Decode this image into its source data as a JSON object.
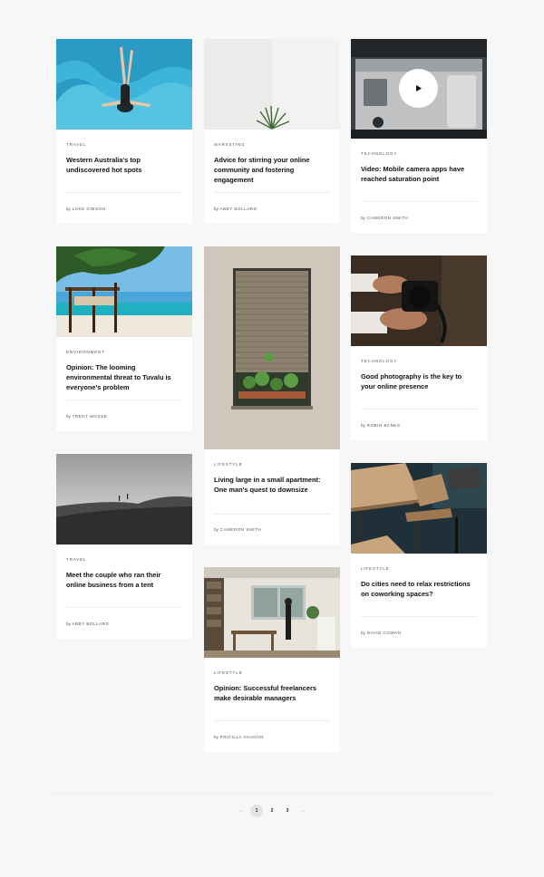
{
  "cards": [
    {
      "category": "TRAVEL",
      "title": "Western Australia's top undiscovered hot spots",
      "by": "by",
      "author": "LUKE GIBSON"
    },
    {
      "category": "MARKETING",
      "title": "Advice for stirring your online community and fostering engagement",
      "by": "by",
      "author": "ABBY BOLLARD"
    },
    {
      "category": "TECHNOLOGY",
      "title": "Video: Mobile camera apps have reached saturation point",
      "by": "by",
      "author": "CAMERON SMITH",
      "play_icon": "play-icon"
    },
    {
      "category": "ENVIRONMENT",
      "title": "Opinion: The looming environmental threat to Tuvalu is everyone's problem",
      "by": "by",
      "author": "TRENT MOSSE"
    },
    {
      "category": "LIFESTYLE",
      "title": "Living large in a small apartment: One man's quest to downsize",
      "by": "by",
      "author": "CAMERON SMITH"
    },
    {
      "category": "TECHNOLOGY",
      "title": "Good photography is the key to your online presence",
      "by": "by",
      "author": "ROBIN BANKS"
    },
    {
      "category": "TRAVEL",
      "title": "Meet the couple who ran their online business from a tent",
      "by": "by",
      "author": "ABBY BOLLARD"
    },
    {
      "category": "LIFESTYLE",
      "title": "Opinion: Successful freelancers make desirable managers",
      "by": "by",
      "author": "PRICILLA VAUGHN"
    },
    {
      "category": "LIFESTYLE",
      "title": "Do cities need to relax restrictions on coworking spaces?",
      "by": "by",
      "author": "DAVID COWAN"
    }
  ],
  "pagination": {
    "prev": "←",
    "pages": [
      "1",
      "2",
      "3"
    ],
    "next": "→",
    "current": "1"
  },
  "colors": {
    "background": "#f7f7f7",
    "card": "#ffffff",
    "text": "#111111",
    "active_page": "#e4e4e4"
  }
}
